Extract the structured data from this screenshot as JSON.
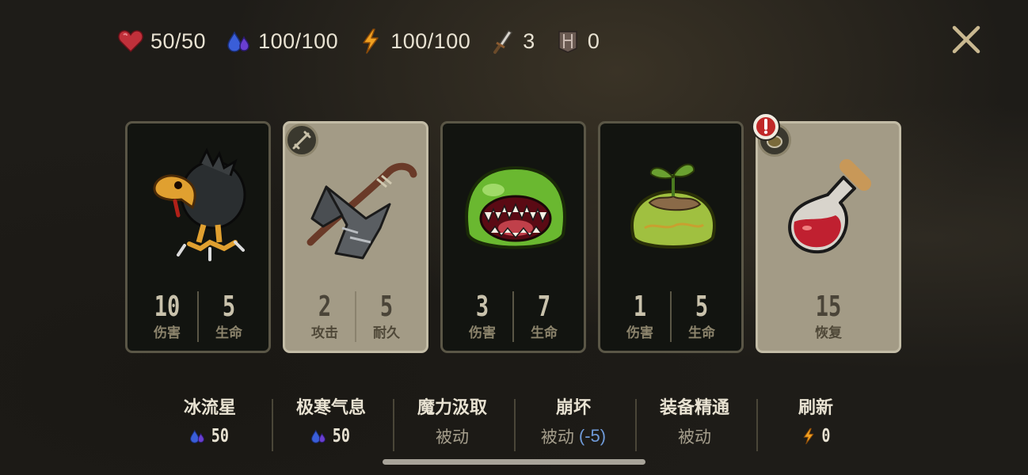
{
  "stats": {
    "health": "50/50",
    "mana": "100/100",
    "energy": "100/100",
    "attack": "3",
    "armor": "0"
  },
  "cards": [
    {
      "style": "dark",
      "art": "crow-bird-icon",
      "left_value": "10",
      "left_label": "伤害",
      "right_value": "5",
      "right_label": "生命"
    },
    {
      "style": "light",
      "art": "battle-axe-icon",
      "badge": "weapon-badge-icon",
      "left_value": "2",
      "left_label": "攻击",
      "right_value": "5",
      "right_label": "耐久"
    },
    {
      "style": "dark",
      "art": "green-slime-mouth-icon",
      "left_value": "3",
      "left_label": "伤害",
      "right_value": "7",
      "right_label": "生命"
    },
    {
      "style": "dark",
      "art": "sprout-slime-icon",
      "left_value": "1",
      "left_label": "伤害",
      "right_value": "5",
      "right_label": "生命"
    },
    {
      "style": "light",
      "art": "health-potion-icon",
      "badge": "item-badge-icon",
      "alert": true,
      "single_value": "15",
      "single_label": "恢复"
    }
  ],
  "skills": [
    {
      "name": "冰流星",
      "cost_icon": "mana-drops-icon",
      "cost": "50"
    },
    {
      "name": "极寒气息",
      "cost_icon": "mana-drops-icon",
      "cost": "50"
    },
    {
      "name": "魔力汲取",
      "status": "被动"
    },
    {
      "name": "崩坏",
      "status": "被动",
      "modifier": "(-5)"
    },
    {
      "name": "装备精通",
      "status": "被动"
    },
    {
      "name": "刷新",
      "cost_icon": "lightning-icon",
      "cost": "0"
    }
  ],
  "colors": {
    "text": "#e8e2d2",
    "passive_text": "#a59e8c",
    "modifier_blue": "#6f9ad8",
    "heart_red": "#c0303a",
    "mana_blue": "#3a5ed8",
    "lightning_orange": "#f0a020"
  }
}
